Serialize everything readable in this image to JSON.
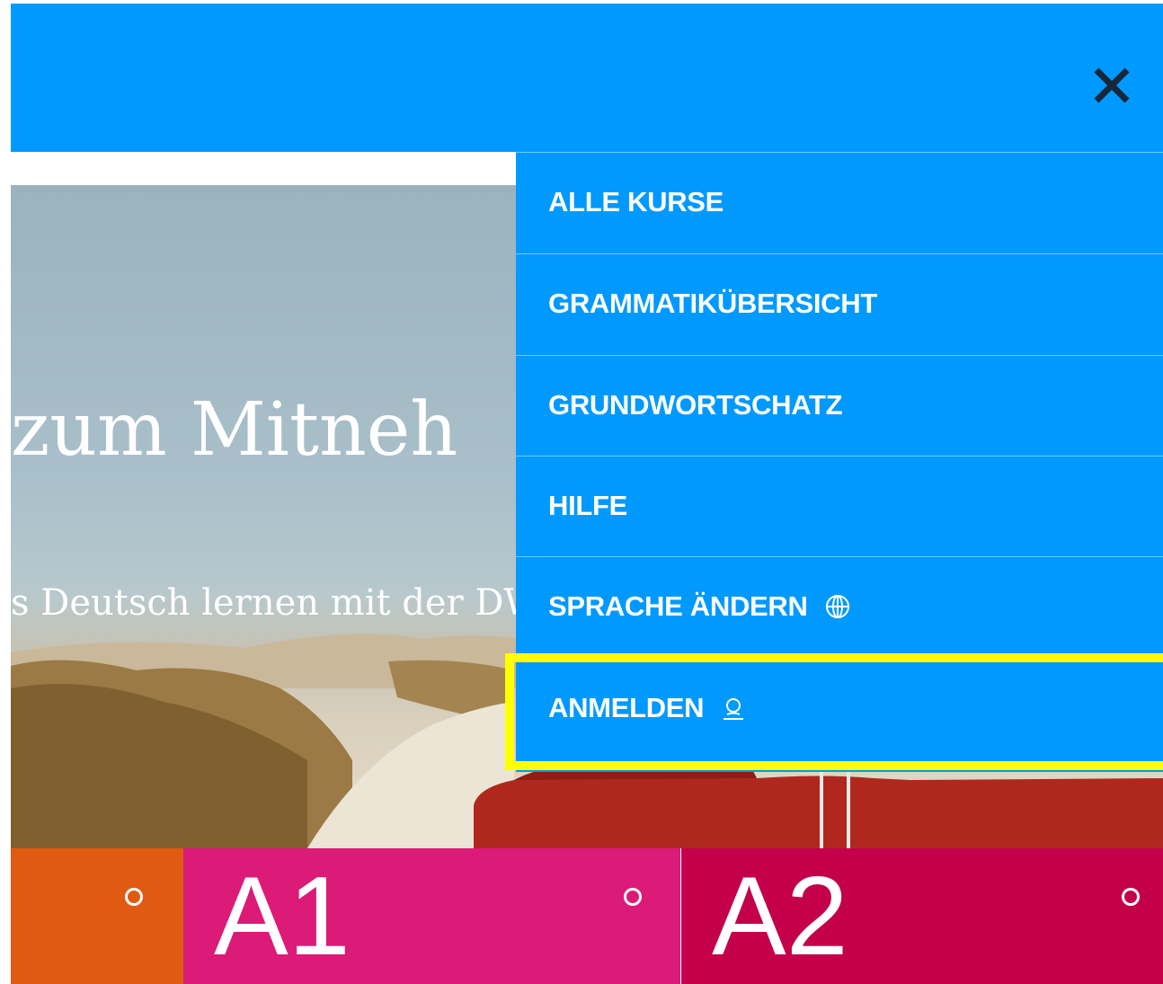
{
  "header": {
    "background_color": "#0099ff",
    "close_icon": "close-icon"
  },
  "hero": {
    "title": "zum Mitneh",
    "subtitle": "s Deutsch lernen mit der DW"
  },
  "menu": {
    "background_color": "#0099ff",
    "items": [
      {
        "label": "ALLE KURSE"
      },
      {
        "label": "GRAMMATIKÜBERSICHT"
      },
      {
        "label": "GRUNDWORTSCHATZ"
      },
      {
        "label": "HILFE"
      },
      {
        "label": "SPRACHE ÄNDERN",
        "icon": "globe-icon"
      },
      {
        "label": "ANMELDEN",
        "icon": "user-icon"
      }
    ],
    "highlight_color": "#ffff00"
  },
  "levels": [
    {
      "label": "",
      "color": "#e05a12"
    },
    {
      "label": "A1",
      "color": "#dc1a78"
    },
    {
      "label": "A2",
      "color": "#c4004b"
    }
  ]
}
